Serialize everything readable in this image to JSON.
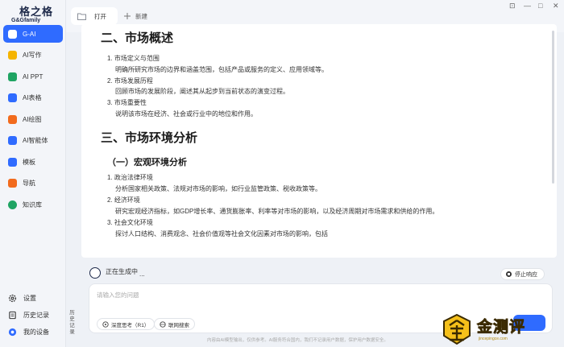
{
  "brand": {
    "name_cn": "格之格",
    "name_en": "G&Gfamily"
  },
  "sidebar": {
    "items": [
      {
        "label": "G-AI",
        "icon": "g-ai-icon",
        "color": "#2f6bff",
        "active": true
      },
      {
        "label": "AI写作",
        "icon": "pen-icon",
        "color": "#f5b400"
      },
      {
        "label": "AI PPT",
        "icon": "ppt-icon",
        "color": "#1fa463"
      },
      {
        "label": "AI表格",
        "icon": "table-icon",
        "color": "#2f6bff"
      },
      {
        "label": "AI绘图",
        "icon": "paint-icon",
        "color": "#f26b1d"
      },
      {
        "label": "AI智能体",
        "icon": "agent-icon",
        "color": "#2f6bff"
      },
      {
        "label": "模板",
        "icon": "template-icon",
        "color": "#2f6bff"
      },
      {
        "label": "导航",
        "icon": "compass-icon",
        "color": "#f26b1d"
      },
      {
        "label": "知识库",
        "icon": "knowledge-icon",
        "color": "#1fa463"
      }
    ],
    "bottom": [
      {
        "label": "设置",
        "icon": "gear-icon"
      },
      {
        "label": "历史记录",
        "icon": "history-icon"
      },
      {
        "label": "我的设备",
        "icon": "device-icon"
      }
    ],
    "history_vertical": "历史记录"
  },
  "tabs": {
    "open_label": "打开",
    "new_label": "新建"
  },
  "window_controls": {
    "minimize": "—",
    "maximize": "□",
    "close": "✕"
  },
  "doc": {
    "h2_1": "二、市场概述",
    "list1": [
      {
        "num": "1.",
        "title": "市场定义与范围",
        "desc": "明确所研究市场的边界和涵盖范围，包括产品或服务的定义、应用领域等。"
      },
      {
        "num": "2.",
        "title": "市场发展历程",
        "desc": "回顾市场的发展阶段，阐述其从起步到当前状态的演变过程。"
      },
      {
        "num": "3.",
        "title": "市场重要性",
        "desc": "说明该市场在经济、社会或行业中的地位和作用。"
      }
    ],
    "h2_2": "三、市场环境分析",
    "h3_1": "（一）宏观环境分析",
    "list2": [
      {
        "num": "1.",
        "title": "政治法律环境",
        "desc": "分析国家相关政策、法规对市场的影响，如行业监管政策、税收政策等。"
      },
      {
        "num": "2.",
        "title": "经济环境",
        "desc": "研究宏观经济指标，如GDP增长率、通货膨胀率、利率等对市场的影响，以及经济周期对市场需求和供给的作用。"
      },
      {
        "num": "3.",
        "title": "社会文化环境",
        "desc": "探讨人口结构、消费观念、社会价值观等社会文化因素对市场的影响，包括"
      }
    ]
  },
  "status": {
    "generating": "正在生成中",
    "dots": "...",
    "stop_label": "停止响应"
  },
  "input": {
    "placeholder": "请输入您的问题",
    "deep_think": "深度思考（R1）",
    "web_search": "联网搜索"
  },
  "footer_note": "内容由AI模型输出，仅供参考。AI服务符合国内，我们不记录用户数据，保护用户数据安全。",
  "watermark": {
    "text": "金测评",
    "sub": "jincepingce.com"
  }
}
